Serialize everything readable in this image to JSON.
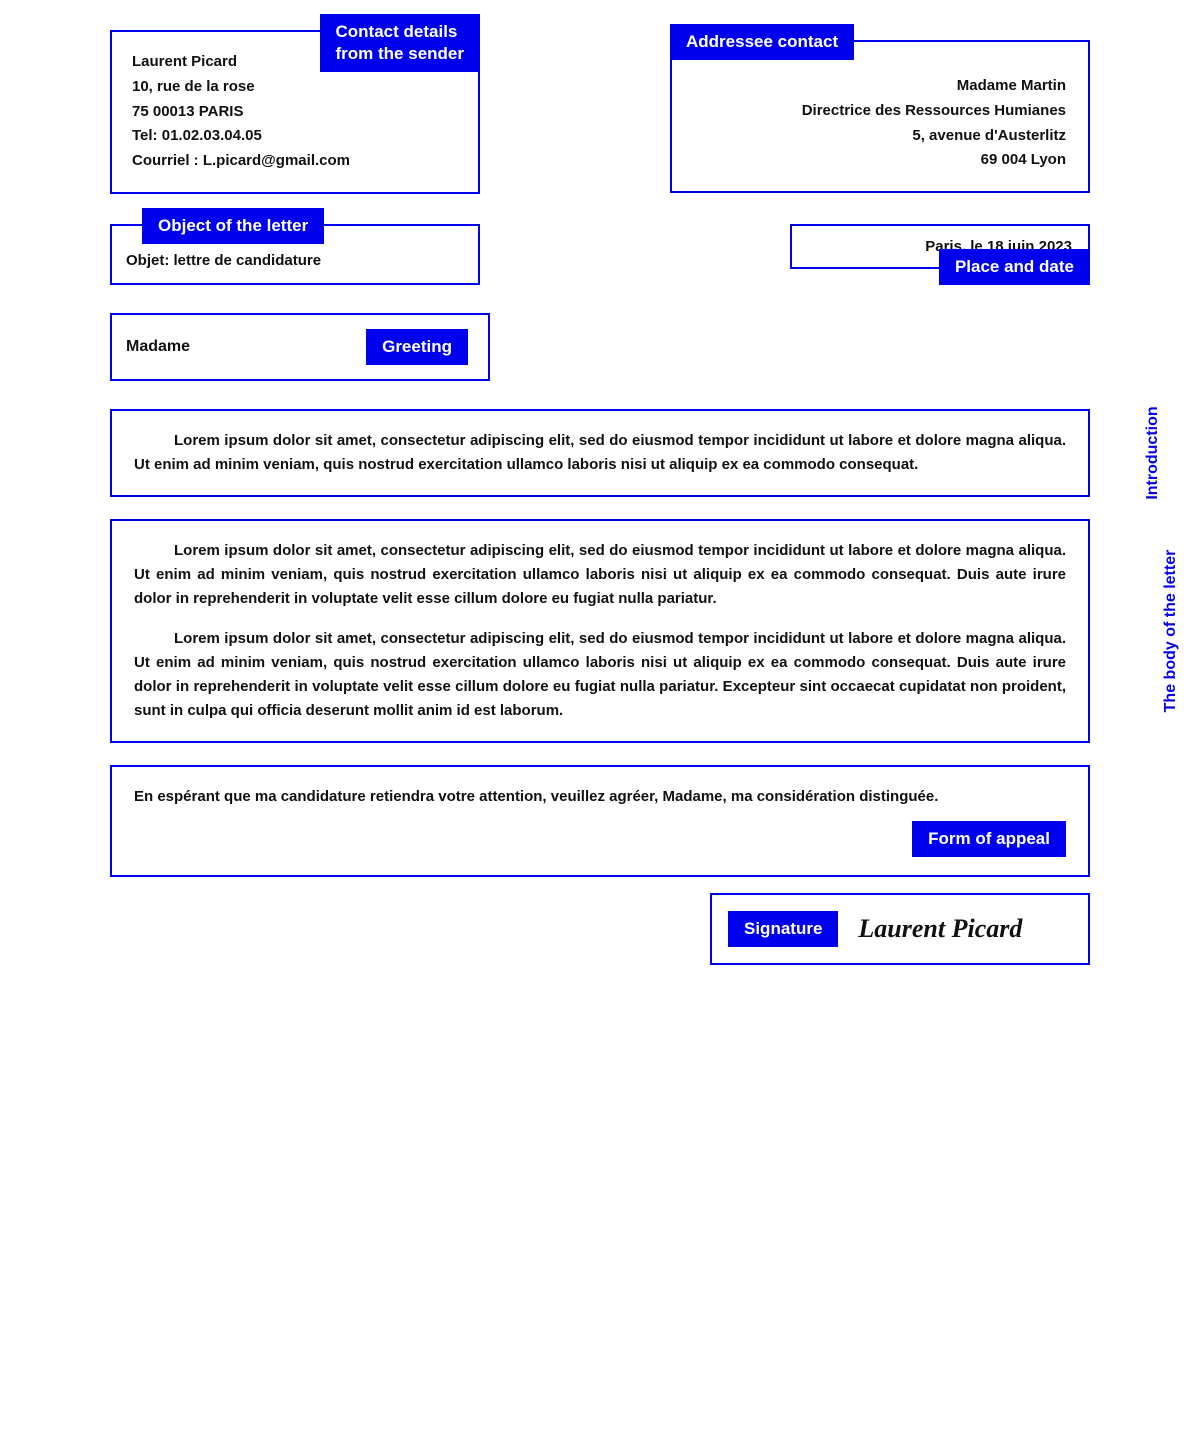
{
  "sender": {
    "badge": "Contact details\nfrom the sender",
    "line1": "Laurent Picard",
    "line2": "10, rue de la rose",
    "line3": "75 00013 PARIS",
    "line4": "Tel: 01.02.03.04.05",
    "line5": "Courriel : L.picard@gmail.com"
  },
  "addressee": {
    "badge": "Addressee contact",
    "line1": "Madame Martin",
    "line2": "Directrice des Ressources Humianes",
    "line3": "5, avenue d'Austerlitz",
    "line4": "69 004 Lyon"
  },
  "object": {
    "badge": "Object of the letter",
    "text": "Objet: lettre de candidature"
  },
  "date": {
    "badge": "Place and date",
    "text": "Paris, le 18 juin 2023"
  },
  "greeting": {
    "badge": "Greeting",
    "text": "Madame"
  },
  "intro": {
    "label": "Introduction",
    "text": "Lorem ipsum dolor sit amet, consectetur adipiscing elit, sed do eiusmod tempor incididunt ut labore et dolore magna aliqua. Ut enim ad minim veniam, quis nostrud exercitation ullamco laboris nisi ut aliquip ex ea commodo consequat."
  },
  "body": {
    "label": "The body of the letter",
    "para1": "Lorem ipsum dolor sit amet, consectetur adipiscing elit, sed do eiusmod tempor incididunt ut labore et dolore magna aliqua. Ut enim ad minim veniam, quis nostrud exercitation ullamco laboris nisi ut aliquip ex ea commodo consequat. Duis aute irure dolor in reprehenderit in voluptate velit esse cillum dolore eu fugiat nulla pariatur.",
    "para2": "Lorem ipsum dolor sit amet, consectetur adipiscing elit, sed do eiusmod tempor incididunt ut labore et dolore magna aliqua. Ut enim ad minim veniam, quis nostrud exercitation ullamco laboris nisi ut aliquip ex ea commodo consequat. Duis aute irure dolor in reprehenderit in voluptate velit esse cillum dolore eu fugiat nulla pariatur. Excepteur sint occaecat cupidatat non proident, sunt in culpa qui officia deserunt mollit anim id est laborum."
  },
  "appeal": {
    "badge": "Form of appeal",
    "text": "En espérant que ma candidature retiendra votre attention, veuillez agréer, Madame, ma considération distinguée."
  },
  "signature": {
    "badge": "Signature",
    "text": "Laurent Picard"
  }
}
